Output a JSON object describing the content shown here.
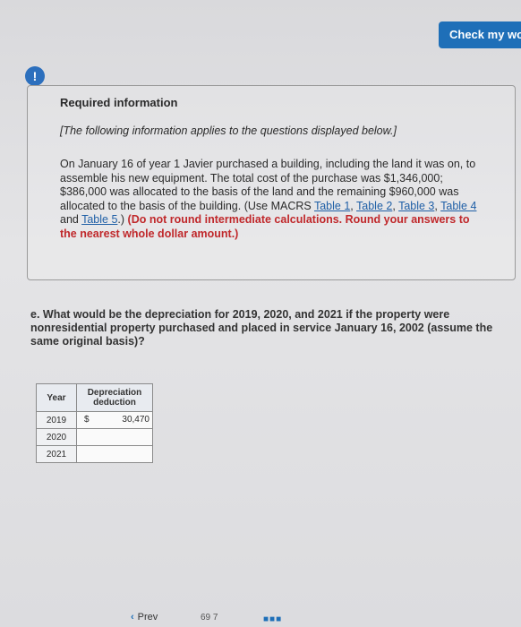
{
  "header": {
    "check_button": "Check my wo"
  },
  "alert_icon": "!",
  "info": {
    "title": "Required information",
    "intro": "[The following information applies to the questions displayed below.]",
    "body_1": "On January 16 of year 1 Javier purchased a building, including the land it was on, to assemble his new equipment. The total cost of the purchase was $1,346,000; $386,000 was allocated to the basis of the land and the remaining $960,000 was allocated to the basis of the building.",
    "use_prefix": "(Use MACRS ",
    "tables": [
      "Table 1",
      "Table 2",
      "Table 3",
      "Table 4",
      "Table 5"
    ],
    "sep_comma": ", ",
    "sep_and": " and ",
    "paren_close": ".) ",
    "instruction": "(Do not round intermediate calculations. Round your answers to the nearest whole dollar amount.)"
  },
  "question": "e. What would be the depreciation for 2019, 2020, and 2021 if the property were nonresidential property purchased and placed in service January 16, 2002 (assume the same original basis)?",
  "table": {
    "headers": [
      "Year",
      "Depreciation deduction"
    ],
    "rows": [
      {
        "year": "2019",
        "currency": "$",
        "value": "30,470"
      },
      {
        "year": "2020",
        "currency": "",
        "value": ""
      },
      {
        "year": "2021",
        "currency": "",
        "value": ""
      }
    ]
  },
  "footer": {
    "prev_label": "Prev",
    "page_mark": "69 7"
  }
}
